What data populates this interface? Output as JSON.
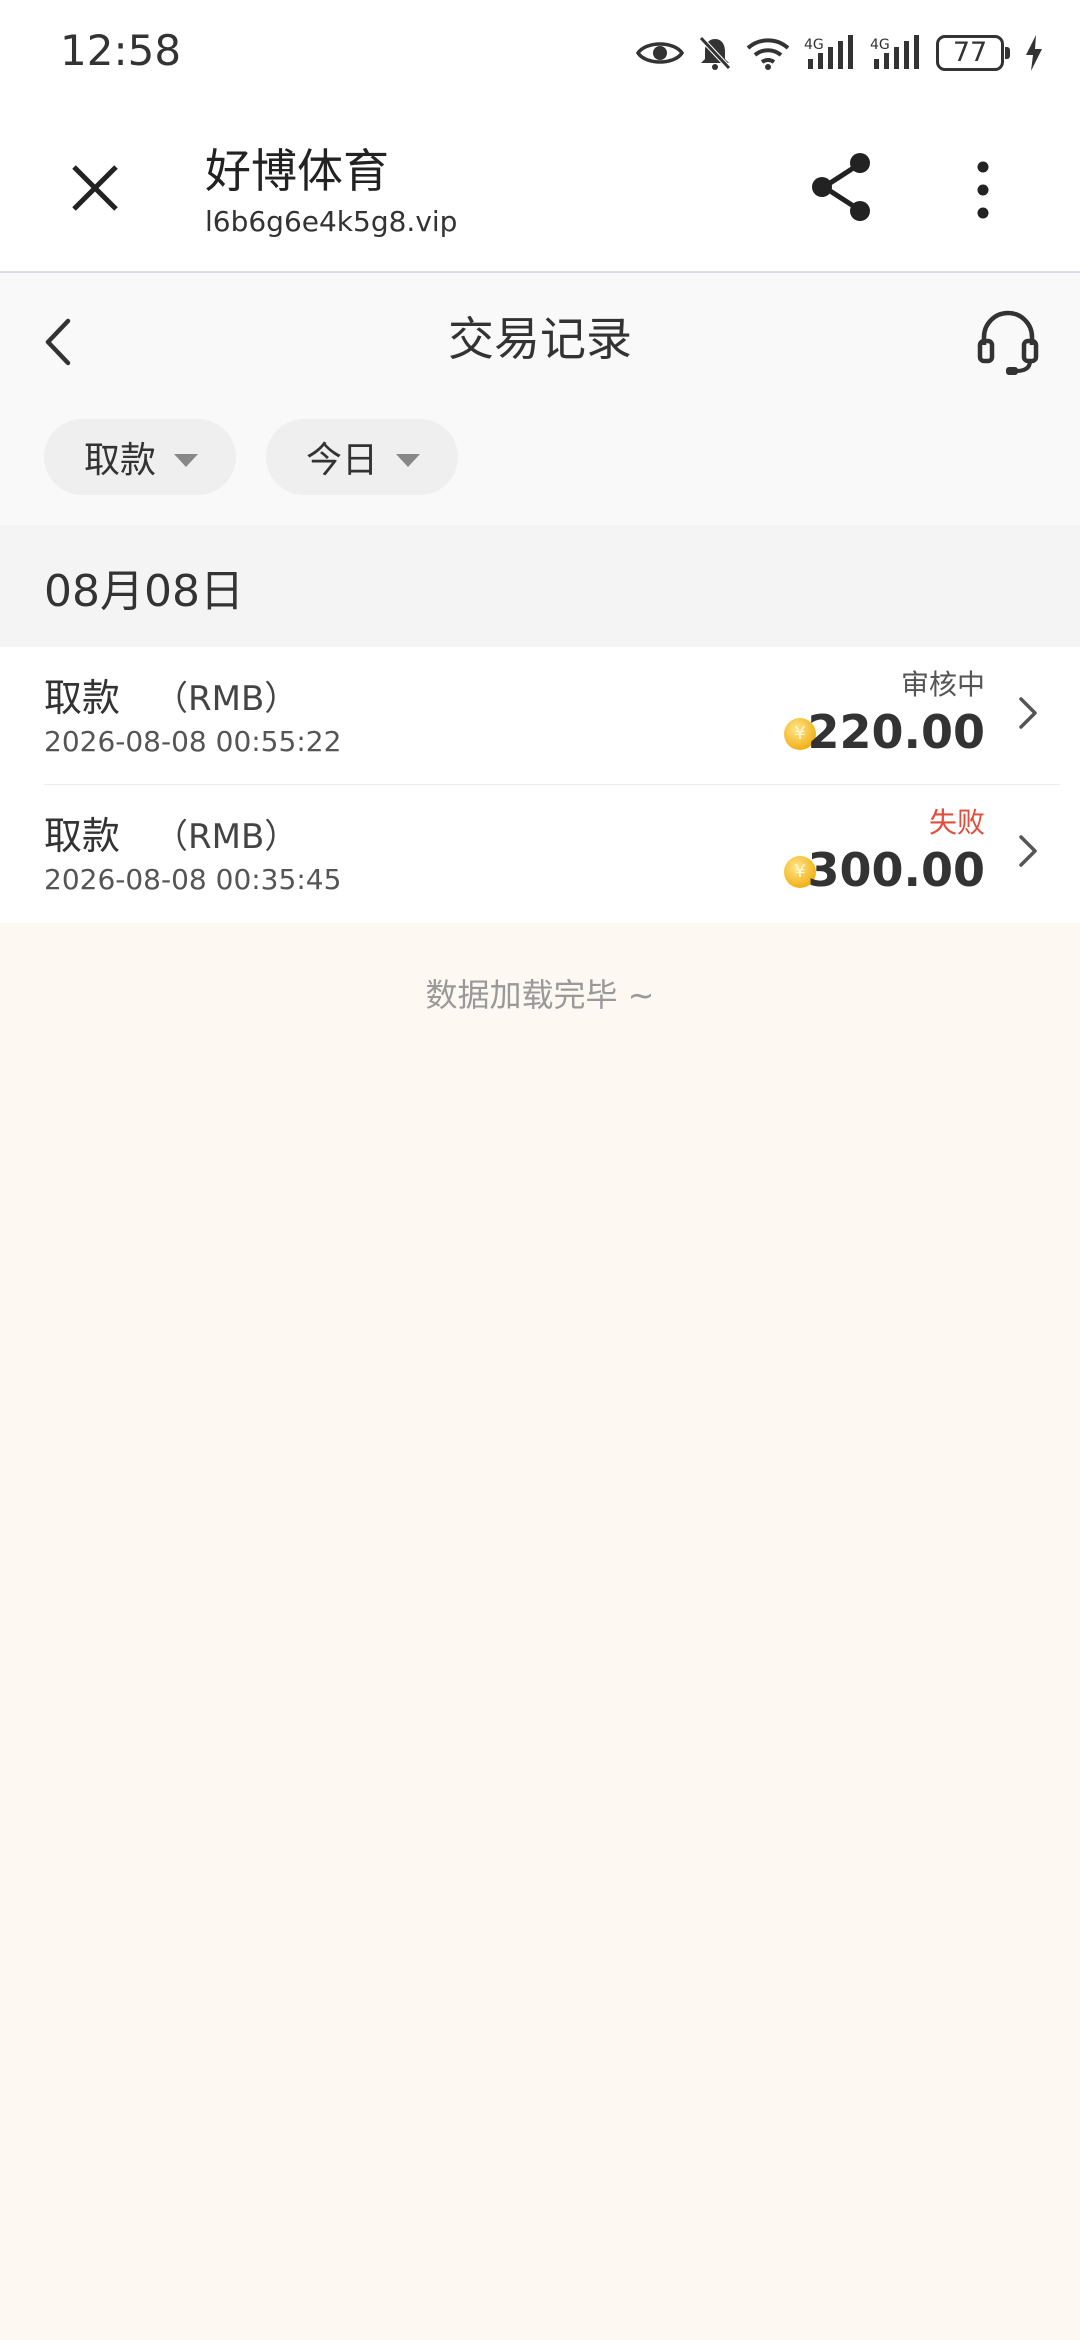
{
  "status_bar": {
    "time": "12:58",
    "battery": "77",
    "icons": [
      "eye-icon",
      "bell-muted-icon",
      "wifi-icon",
      "signal-4g-icon",
      "signal-4g-icon",
      "battery-icon",
      "charging-icon"
    ]
  },
  "browser": {
    "title": "好博体育",
    "url": "l6b6g6e4k5g8.vip",
    "icons": [
      "close-icon",
      "share-icon",
      "more-vertical-icon"
    ]
  },
  "page": {
    "title": "交易记录",
    "filters": {
      "type_label": "取款",
      "date_label": "今日"
    }
  },
  "group": {
    "date": "08月08日"
  },
  "records": [
    {
      "type": "取款",
      "currency": "（RMB）",
      "time": "2026-08-08 00:55:22",
      "status": "审核中",
      "status_color": "#555555",
      "coin": "¥",
      "amount": "220.00"
    },
    {
      "type": "取款",
      "currency": "（RMB）",
      "time": "2026-08-08 00:35:45",
      "status": "失败",
      "status_color": "#e34b3c",
      "coin": "¥",
      "amount": "300.00"
    }
  ],
  "footer": {
    "end_text": "数据加载完毕 ~"
  }
}
